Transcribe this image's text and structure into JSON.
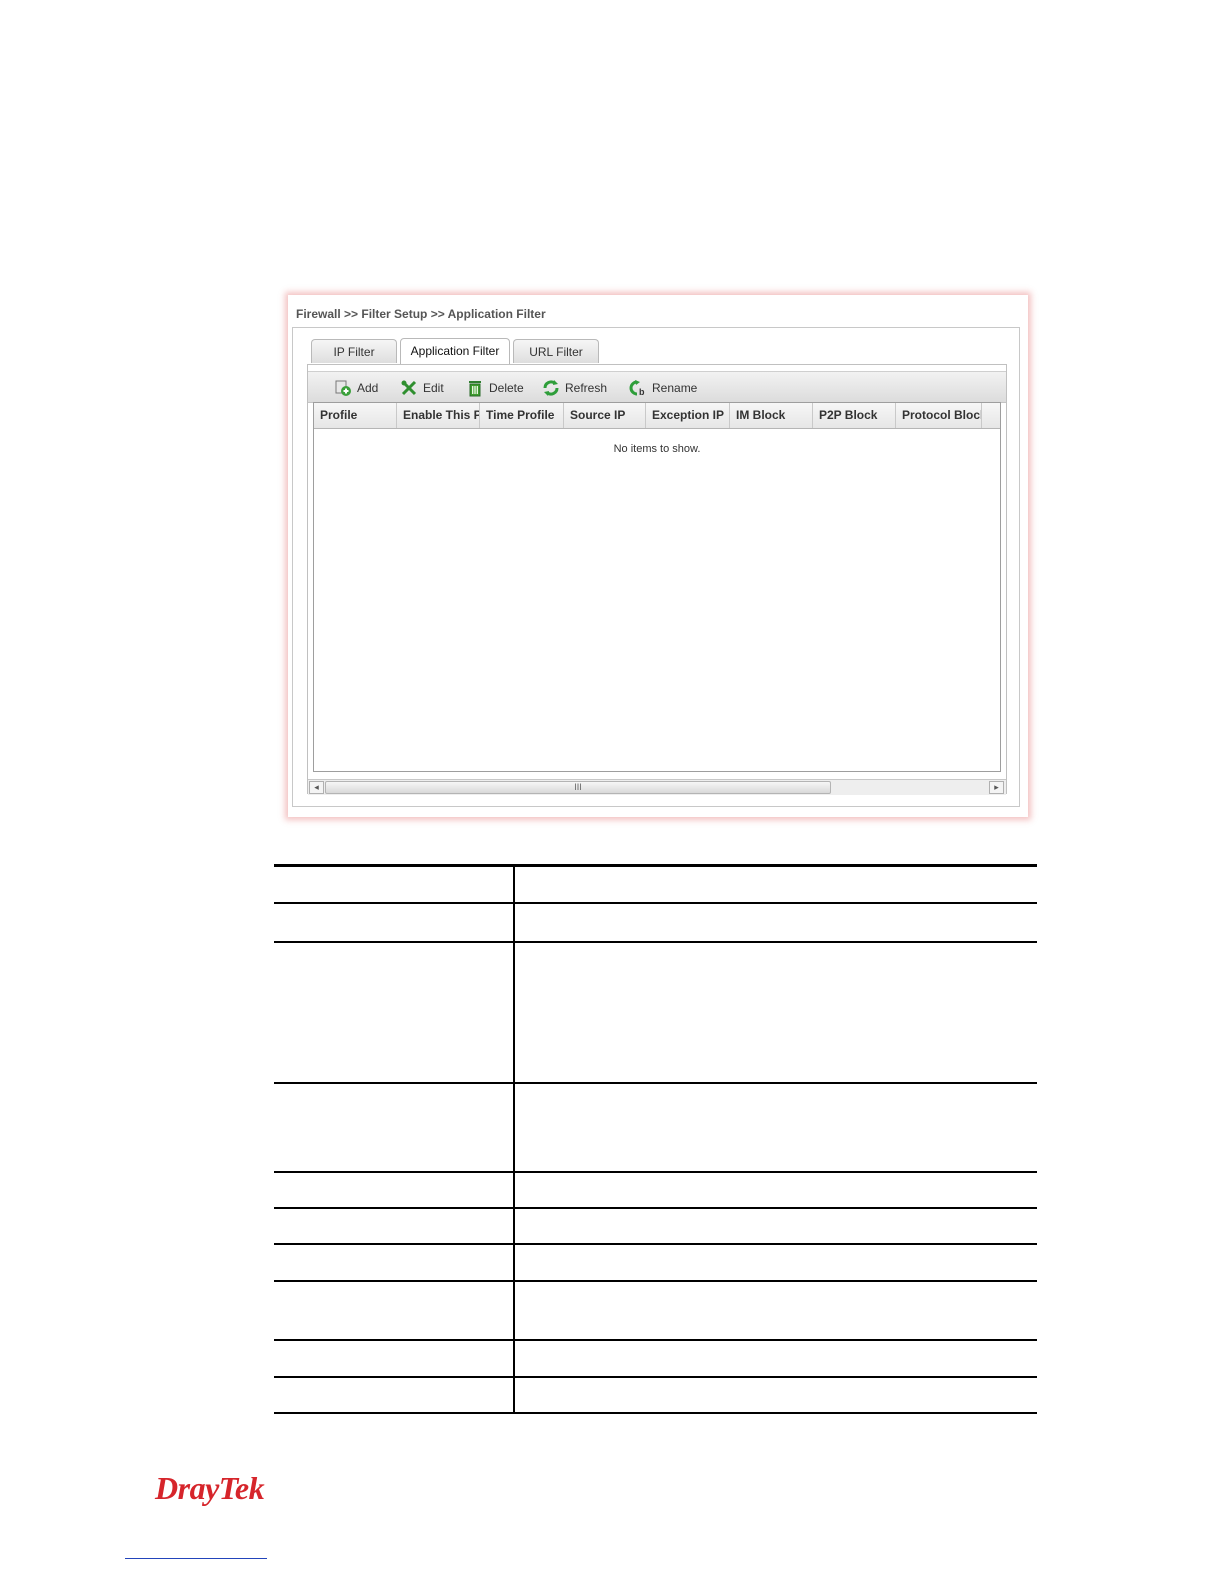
{
  "breadcrumb": "Firewall >> Filter Setup >> Application Filter",
  "tabs": [
    {
      "label": "IP Filter",
      "active": false
    },
    {
      "label": "Application Filter",
      "active": true
    },
    {
      "label": "URL Filter",
      "active": false
    }
  ],
  "toolbar": {
    "add": "Add",
    "edit": "Edit",
    "delete": "Delete",
    "refresh": "Refresh",
    "rename": "Rename"
  },
  "columns": [
    "Profile",
    "Enable This P",
    "Time Profile",
    "Source IP",
    "Exception IP",
    "IM Block",
    "P2P Block",
    "Protocol Block"
  ],
  "empty_message": "No items to show.",
  "scrollbar": {
    "left": "◂",
    "right": "▸",
    "grip": "III"
  },
  "logo": {
    "brand": "DrayTek",
    "color": "#d6252b"
  },
  "colors": {
    "refresh_green": "#2e9e3a",
    "edit_green": "#2f8f2f",
    "delete_green": "#3c9c2c"
  }
}
